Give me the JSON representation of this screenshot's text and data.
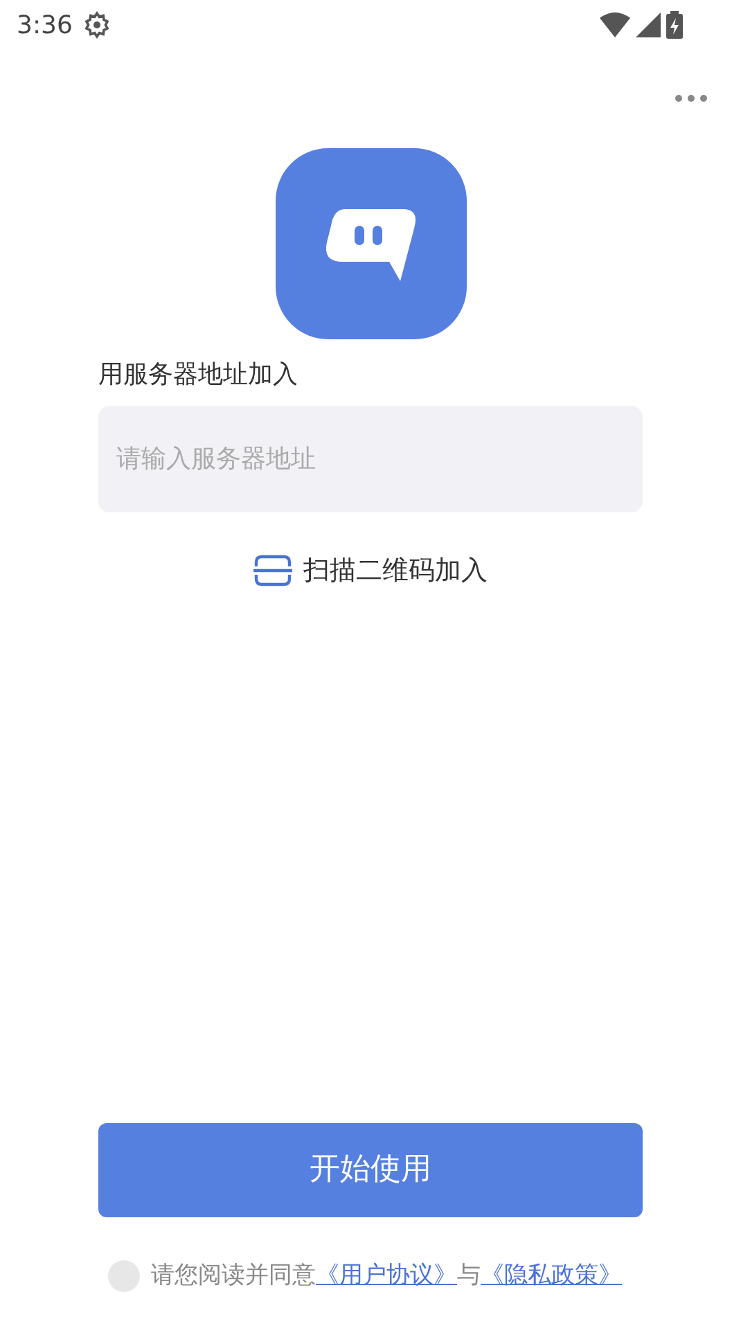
{
  "status_bar": {
    "time": "3:36"
  },
  "server_join": {
    "label": "用服务器地址加入",
    "placeholder": "请输入服务器地址"
  },
  "scan_join": {
    "label": "扫描二维码加入"
  },
  "start_button": {
    "label": "开始使用"
  },
  "agreement": {
    "checked": false,
    "text": "请您阅读并同意",
    "terms_link": "《用户协议》",
    "conjunction": "与",
    "privacy_link": "《隐私政策》"
  }
}
